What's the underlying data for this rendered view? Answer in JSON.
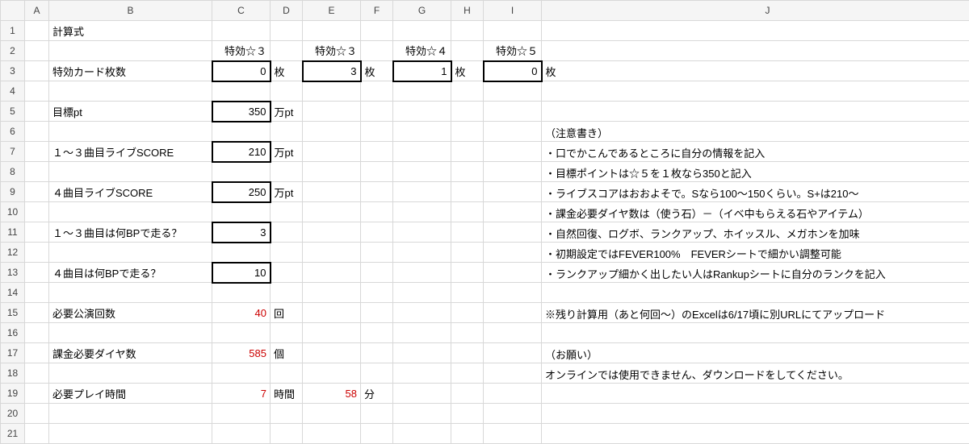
{
  "columns": [
    "A",
    "B",
    "C",
    "D",
    "E",
    "F",
    "G",
    "H",
    "I",
    "J"
  ],
  "rows": [
    "1",
    "2",
    "3",
    "4",
    "5",
    "6",
    "7",
    "8",
    "9",
    "10",
    "11",
    "12",
    "13",
    "14",
    "15",
    "16",
    "17",
    "18",
    "19",
    "20",
    "21"
  ],
  "b1": "計算式",
  "row2": {
    "c": "特効☆３",
    "e": "特効☆３",
    "g": "特効☆４",
    "i": "特効☆５"
  },
  "row3": {
    "b": "特効カード枚数",
    "c": "0",
    "d": "枚",
    "e": "3",
    "f": "枚",
    "g": "1",
    "h": "枚",
    "i": "0",
    "j_unit": "枚"
  },
  "row5": {
    "b": "目標pt",
    "c": "350",
    "d": "万pt"
  },
  "row6": {
    "j": "（注意書き）"
  },
  "row7": {
    "b": "１～３曲目ライブSCORE",
    "c": "210",
    "d": "万pt",
    "j": "・口でかこんであるところに自分の情報を記入"
  },
  "row8": {
    "j": "・目標ポイントは☆５を１枚なら350と記入"
  },
  "row9": {
    "b": "４曲目ライブSCORE",
    "c": "250",
    "d": "万pt",
    "j": "・ライブスコアはおおよそで。Sなら100～150くらい。S+は210～"
  },
  "row10": {
    "j": "・課金必要ダイヤ数は（使う石）－（イベ中もらえる石やアイテム）"
  },
  "row11": {
    "b": "１～３曲目は何BPで走る？",
    "c": "3",
    "j": "・自然回復、ログボ、ランクアップ、ホイッスル、メガホンを加味"
  },
  "row12": {
    "j": "・初期設定ではFEVER100%　FEVERシートで細かい調整可能"
  },
  "row13": {
    "b": "４曲目は何BPで走る？",
    "c": "10",
    "j": "・ランクアップ細かく出したい人はRankupシートに自分のランクを記入"
  },
  "row15": {
    "b": "必要公演回数",
    "c": "40",
    "d": "回",
    "j": "※残り計算用（あと何回～）のExcelは6/17頃に別URLにてアップロード"
  },
  "row17": {
    "b": "課金必要ダイヤ数",
    "c": "585",
    "d": "個",
    "j": "（お願い）"
  },
  "row18": {
    "j": "オンラインでは使用できません、ダウンロードをしてください。"
  },
  "row19": {
    "b": "必要プレイ時間",
    "c": "7",
    "d": "時間",
    "e": "58",
    "f": "分"
  }
}
